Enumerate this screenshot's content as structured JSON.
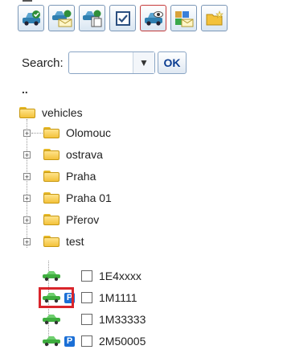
{
  "toolbar": {
    "buttons": [
      {
        "name": "vehicle-button",
        "icon": "car-icon"
      },
      {
        "name": "vehicle-message-button",
        "icon": "car-envelope-icon"
      },
      {
        "name": "vehicle-documents-button",
        "icon": "car-documents-icon"
      },
      {
        "name": "check-button",
        "icon": "checkbox-icon"
      },
      {
        "name": "vehicle-view-button",
        "icon": "car-eye-icon"
      },
      {
        "name": "users-message-button",
        "icon": "users-envelope-icon"
      },
      {
        "name": "new-folder-button",
        "icon": "folder-new-icon"
      }
    ]
  },
  "search": {
    "label": "Search:",
    "value": "",
    "ok_label": "OK"
  },
  "tree": {
    "up_label": "..",
    "root": "vehicles",
    "folders": [
      "Olomouc",
      "ostrava",
      "Praha",
      "Praha 01",
      "Přerov",
      "test"
    ],
    "vehicles": [
      {
        "label": "1E4xxxx",
        "parked": false
      },
      {
        "label": "1M1111",
        "parked": true
      },
      {
        "label": "1M33333",
        "parked": false
      },
      {
        "label": "2M50005",
        "parked": true
      }
    ]
  },
  "colors": {
    "accent": "#1b6fd6",
    "selection": "#d9252b",
    "car": "#3fae3f"
  }
}
